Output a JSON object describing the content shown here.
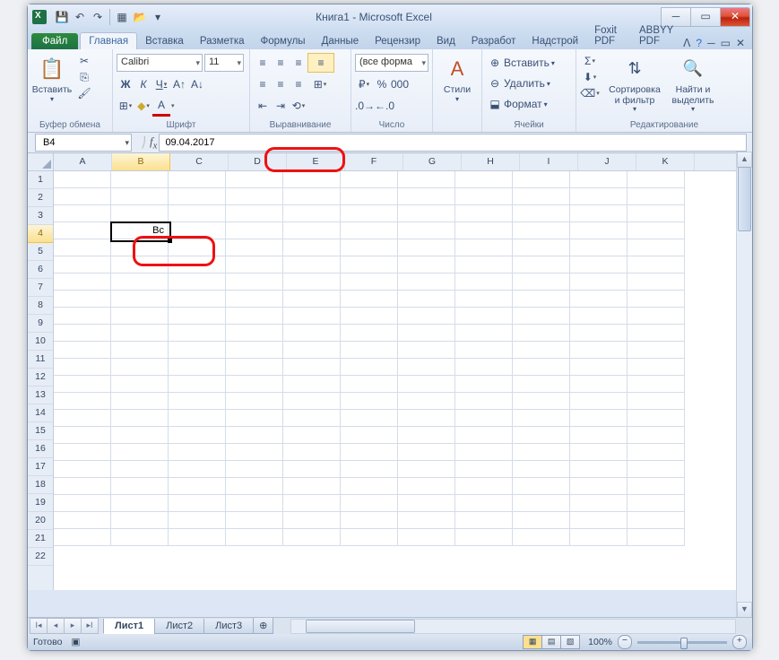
{
  "title": {
    "doc": "Книга1",
    "app": "Microsoft Excel"
  },
  "tabs": {
    "file": "Файл",
    "items": [
      "Главная",
      "Вставка",
      "Разметка",
      "Формулы",
      "Данные",
      "Рецензир",
      "Вид",
      "Разработ",
      "Надстрой",
      "Foxit PDF",
      "ABBYY PDF"
    ],
    "active": 0
  },
  "ribbon": {
    "clipboard": {
      "paste": "Вставить",
      "label": "Буфер обмена"
    },
    "font": {
      "name": "Calibri",
      "size": "11",
      "label": "Шрифт"
    },
    "align": {
      "label": "Выравнивание",
      "wrap": "",
      "merge": ""
    },
    "number": {
      "fmt": "(все форма",
      "label": "Число"
    },
    "styles": {
      "btn": "Стили",
      "label": ""
    },
    "cells": {
      "ins": "Вставить",
      "del": "Удалить",
      "fmt": "Формат",
      "label": "Ячейки"
    },
    "editing": {
      "sort": "Сортировка и фильтр",
      "find": "Найти и выделить",
      "label": "Редактирование"
    }
  },
  "namebox": "B4",
  "formula": "09.04.2017",
  "columns": [
    "A",
    "B",
    "C",
    "D",
    "E",
    "F",
    "G",
    "H",
    "I",
    "J",
    "K"
  ],
  "rows": [
    "1",
    "2",
    "3",
    "4",
    "5",
    "6",
    "7",
    "8",
    "9",
    "10",
    "11",
    "12",
    "13",
    "14",
    "15",
    "16",
    "17",
    "18",
    "19",
    "20",
    "21",
    "22"
  ],
  "activeCol": 1,
  "activeRow": 3,
  "cellValue": "Вс",
  "sheets": [
    "Лист1",
    "Лист2",
    "Лист3"
  ],
  "activeSheet": 0,
  "status": {
    "ready": "Готово",
    "zoom": "100%"
  }
}
